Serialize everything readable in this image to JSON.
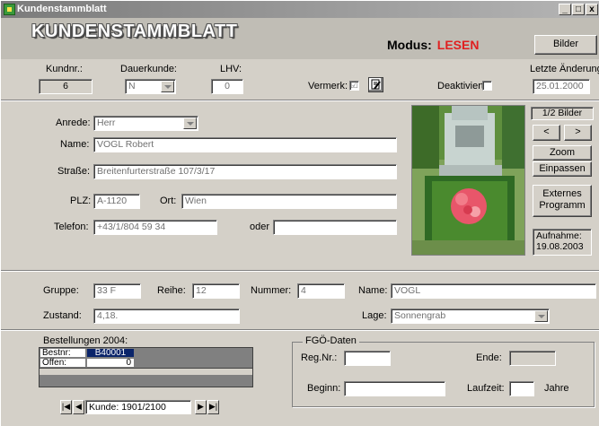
{
  "window": {
    "title": "Kundenstammblatt",
    "minimize": "_",
    "maximize": "□",
    "close": "x"
  },
  "header": {
    "title": "KUNDENSTAMMBLATT",
    "modus_label": "Modus:",
    "modus_value": "LESEN",
    "bilder_button": "Bilder"
  },
  "topfields": {
    "kundnr_label": "Kundnr.:",
    "kundnr_value": "6",
    "dauerkunde_label": "Dauerkunde:",
    "dauerkunde_value": "N",
    "lhv_label": "LHV:",
    "lhv_value": "0",
    "vermerk_label": "Vermerk:",
    "vermerk_checked": "☑",
    "deaktiviert_label": "Deaktiviert:",
    "letzte_label": "Letzte Änderung:",
    "letzte_value": "25.01.2000"
  },
  "person": {
    "anrede_label": "Anrede:",
    "anrede_value": "Herr",
    "name_label": "Name:",
    "name_value": "VOGL Robert",
    "strasse_label": "Straße:",
    "strasse_value": "Breitenfurterstraße 107/3/17",
    "plz_label": "PLZ:",
    "plz_value": "A-1120",
    "ort_label": "Ort:",
    "ort_value": "Wien",
    "telefon_label": "Telefon:",
    "telefon_value": "+43/1/804 59 34",
    "oder_label": "oder",
    "oder_value": ""
  },
  "image_panel": {
    "counter": "1/2 Bilder",
    "prev": "<",
    "next": ">",
    "zoom": "Zoom",
    "einpassen": "Einpassen",
    "extern_line1": "Externes",
    "extern_line2": "Programm",
    "aufnahme_line1": "Aufnahme:",
    "aufnahme_line2": "19.08.2003"
  },
  "grave": {
    "gruppe_label": "Gruppe:",
    "gruppe_value": "33 F",
    "reihe_label": "Reihe:",
    "reihe_value": "12",
    "nummer_label": "Nummer:",
    "nummer_value": "4",
    "name_label": "Name:",
    "name_value": "VOGL",
    "zustand_label": "Zustand:",
    "zustand_value": "4,18.",
    "lage_label": "Lage:",
    "lage_value": "Sonnengrab"
  },
  "orders": {
    "title": "Bestellungen 2004:",
    "bestnr_label": "Bestnr:",
    "bestnr_value": "B40001",
    "offen_label": "Offen:",
    "offen_value": "0"
  },
  "navigation": {
    "first": "|◀",
    "prev": "◀",
    "record": "Kunde: 1901/2100",
    "next": "▶",
    "last": "▶|"
  },
  "fgo": {
    "title": "FGÖ-Daten",
    "regnr_label": "Reg.Nr.:",
    "regnr_value": "",
    "ende_label": "Ende:",
    "ende_value": "",
    "beginn_label": "Beginn:",
    "beginn_value": "",
    "laufzeit_label": "Laufzeit:",
    "laufzeit_value": "",
    "jahre_label": "Jahre"
  },
  "colors": {
    "modus_value": "#e02020",
    "selected_cell": "#0a246a",
    "title_bar": "#7b7b7b"
  }
}
